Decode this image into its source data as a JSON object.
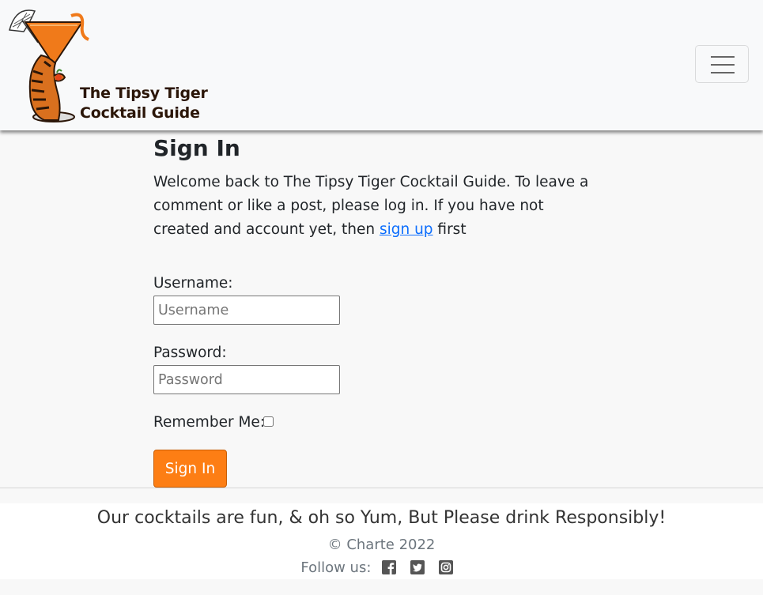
{
  "header": {
    "brand_line1": "The Tipsy Tiger",
    "brand_line2": "Cocktail Guide",
    "menu_icon": "hamburger-menu-icon"
  },
  "signin": {
    "title": "Sign In",
    "intro_before": "Welcome back to The Tipsy Tiger Cocktail Guide. To leave a comment or like a post, please log in. If you have not created and account yet, then ",
    "signup_link": "sign up",
    "intro_after": " first",
    "username_label": "Username:",
    "username_placeholder": "Username",
    "password_label": "Password:",
    "password_placeholder": "Password",
    "remember_label": "Remember Me:",
    "button_label": "Sign In"
  },
  "footer": {
    "tagline": "Our cocktails are fun, & oh so Yum, But Please drink Responsibly!",
    "copyright": "© Charte 2022",
    "follow_label": "Follow us:",
    "social_icons": [
      "facebook-icon",
      "twitter-icon",
      "instagram-icon"
    ]
  },
  "colors": {
    "accent_orange": "#fd7e14",
    "link_blue": "#0d6efd",
    "navbar_bg": "#f8f9fa"
  }
}
